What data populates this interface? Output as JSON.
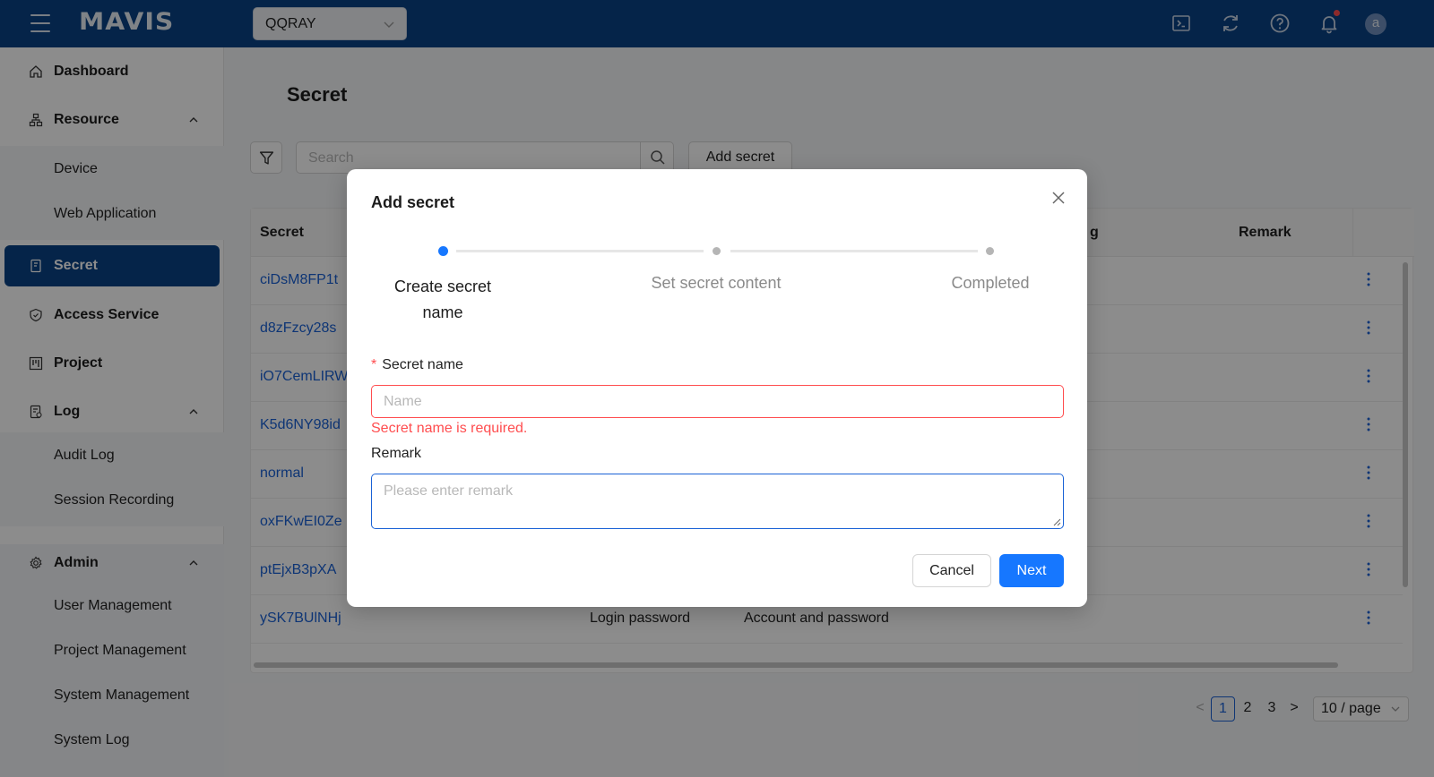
{
  "app": {
    "logo": "MAVIS",
    "project": "QQRAY",
    "avatar_letter": "a"
  },
  "topbar_icons": [
    "terminal-icon",
    "refresh-icon",
    "help-icon",
    "bell-icon"
  ],
  "sidebar": {
    "dashboard": "Dashboard",
    "resource": "Resource",
    "device": "Device",
    "web_application": "Web Application",
    "secret": "Secret",
    "access_service": "Access Service",
    "project": "Project",
    "log": "Log",
    "audit_log": "Audit Log",
    "session_recording": "Session Recording",
    "admin": "Admin",
    "user_management": "User Management",
    "project_management": "Project Management",
    "system_management": "System Management",
    "system_log": "System Log"
  },
  "main": {
    "title": "Secret",
    "search_placeholder": "Search",
    "add_button": "Add secret",
    "columns": {
      "secret": "Secret",
      "partial_col": "g",
      "remark": "Remark"
    },
    "rows": [
      {
        "name": "ciDsM8FP1t",
        "type": "",
        "kind": ""
      },
      {
        "name": "d8zFzcy28s",
        "type": "",
        "kind": ""
      },
      {
        "name": "iO7CemLIRW",
        "type": "",
        "kind": ""
      },
      {
        "name": "K5d6NY98id",
        "type": "",
        "kind": ""
      },
      {
        "name": "normal",
        "type": "",
        "kind": ""
      },
      {
        "name": "oxFKwEI0Ze",
        "type": "",
        "kind": ""
      },
      {
        "name": "ptEjxB3pXA",
        "type": "",
        "kind": ""
      },
      {
        "name": "ySK7BUlNHj",
        "type": "Login password",
        "kind": "Account and password"
      }
    ],
    "pagination": {
      "pages": [
        "1",
        "2",
        "3"
      ],
      "current": "1",
      "page_size": "10 / page",
      "prev": "<",
      "next": ">"
    }
  },
  "modal": {
    "title": "Add secret",
    "steps": [
      {
        "label": "Create secret name",
        "state": "active"
      },
      {
        "label": "Set secret content",
        "state": "pending"
      },
      {
        "label": "Completed",
        "state": "pending"
      }
    ],
    "name_label": "Secret name",
    "name_required_star": "*",
    "name_placeholder": "Name",
    "name_error": "Secret name is required.",
    "remark_label": "Remark",
    "remark_placeholder": "Please enter remark",
    "cancel": "Cancel",
    "next": "Next"
  },
  "colors": {
    "brand": "#0a4285",
    "primary": "#1677ff",
    "error": "#ff4d4f",
    "link": "#1a62d6"
  }
}
